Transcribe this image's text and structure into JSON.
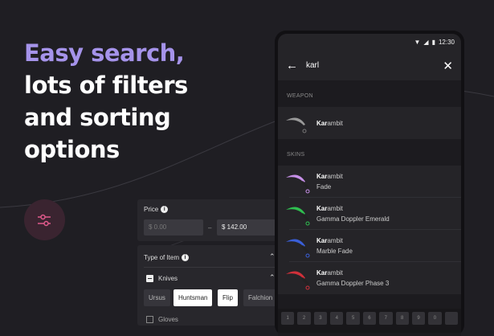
{
  "headline": {
    "accent": "Easy search,",
    "lines": [
      "lots of filters",
      "and sorting",
      "options"
    ]
  },
  "colors": {
    "accent": "#a593ea",
    "background": "#1f1e23",
    "filter_icon": "#e05a8c"
  },
  "filter_panel": {
    "price": {
      "label": "Price",
      "min_placeholder": "$ 0.00",
      "separator": "–",
      "max_value": "$ 142.00"
    },
    "type_of_item": {
      "label": "Type of Item",
      "groups": [
        {
          "label": "Knives",
          "checked": "partial",
          "chips": [
            {
              "label": "Ursus",
              "selected": false
            },
            {
              "label": "Huntsman",
              "selected": true
            },
            {
              "label": "Flip",
              "selected": true
            },
            {
              "label": "Falchion",
              "selected": false
            }
          ]
        },
        {
          "label": "Gloves",
          "checked": false
        }
      ]
    }
  },
  "phone": {
    "status": {
      "time": "12:30"
    },
    "search": {
      "query": "karl"
    },
    "sections": [
      {
        "title": "WEAPON",
        "items": [
          {
            "match": "Kar",
            "rest": "ambit",
            "color": "#9a9a9a"
          }
        ]
      },
      {
        "title": "SKINS",
        "items": [
          {
            "match": "Kar",
            "rest": "ambit",
            "skin": "Fade",
            "color": "#c790e8"
          },
          {
            "match": "Kar",
            "rest": "ambit",
            "skin": "Gamma Doppler Emerald",
            "color": "#2fbf50"
          },
          {
            "match": "Kar",
            "rest": "ambit",
            "skin": "Marble Fade",
            "color": "#3a5fd8"
          },
          {
            "match": "Kar",
            "rest": "ambit",
            "skin": "Gamma Doppler Phase 3",
            "color": "#d0303a"
          }
        ]
      }
    ],
    "keyboard": [
      "1",
      "2",
      "3",
      "4",
      "5",
      "6",
      "7",
      "8",
      "9",
      "0"
    ]
  }
}
